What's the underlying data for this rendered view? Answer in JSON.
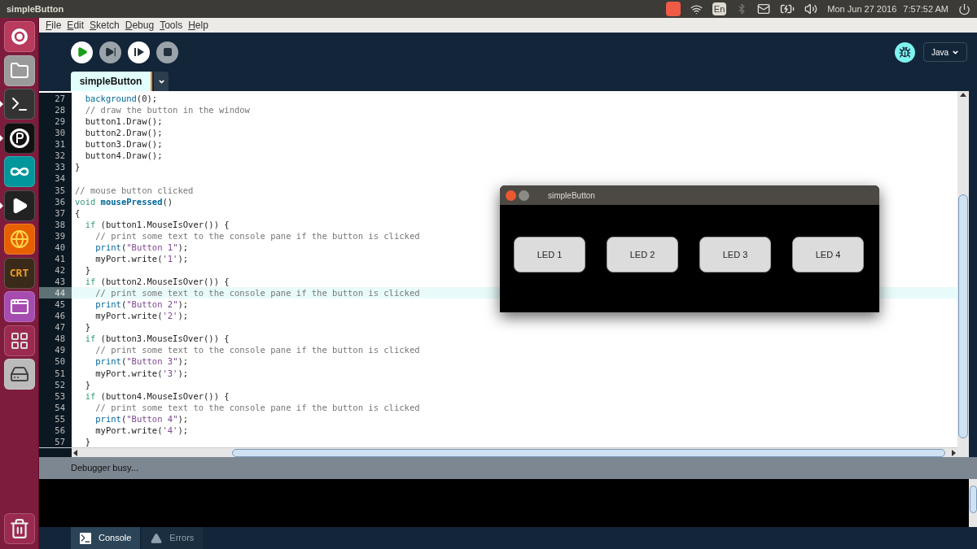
{
  "top_panel": {
    "title": "simpleButton",
    "keyboard": "En",
    "date": "Mon Jun 27 2016",
    "time": "7:57:52 AM"
  },
  "launcher": [
    {
      "kind": "dash",
      "running": false
    },
    {
      "kind": "files",
      "running": false
    },
    {
      "kind": "terminal",
      "running": true
    },
    {
      "kind": "processing",
      "running": true
    },
    {
      "kind": "arduino",
      "running": false
    },
    {
      "kind": "player",
      "running": true
    },
    {
      "kind": "firefox",
      "running": false
    },
    {
      "kind": "crt",
      "label": "CRT",
      "running": false
    },
    {
      "kind": "window",
      "running": false
    },
    {
      "kind": "workspaces",
      "running": false
    },
    {
      "kind": "drive",
      "running": false
    },
    {
      "kind": "trash",
      "running": false
    }
  ],
  "menu": [
    "File",
    "Edit",
    "Sketch",
    "Debug",
    "Tools",
    "Help"
  ],
  "toolbar": [
    {
      "kind": "run",
      "disabled": false
    },
    {
      "kind": "step",
      "disabled": true
    },
    {
      "kind": "continue",
      "disabled": false
    },
    {
      "kind": "stop",
      "disabled": true
    }
  ],
  "mode": {
    "label": "Java"
  },
  "tabs": [
    {
      "label": "simpleButton",
      "selected": true
    }
  ],
  "editor": {
    "lines": [
      {
        "number": "27",
        "current": false,
        "tokens": [
          {
            "kind": "func",
            "text": "  background"
          },
          {
            "kind": "plain",
            "text": "(0);"
          }
        ]
      },
      {
        "number": "28",
        "current": false,
        "tokens": [
          {
            "kind": "comment",
            "text": "  // draw the button in the window"
          }
        ]
      },
      {
        "number": "29",
        "current": false,
        "tokens": [
          {
            "kind": "plain",
            "text": "  button1.Draw();"
          }
        ]
      },
      {
        "number": "30",
        "current": false,
        "tokens": [
          {
            "kind": "plain",
            "text": "  button2.Draw();"
          }
        ]
      },
      {
        "number": "31",
        "current": false,
        "tokens": [
          {
            "kind": "plain",
            "text": "  button3.Draw();"
          }
        ]
      },
      {
        "number": "32",
        "current": false,
        "tokens": [
          {
            "kind": "plain",
            "text": "  button4.Draw();"
          }
        ]
      },
      {
        "number": "33",
        "current": false,
        "tokens": [
          {
            "kind": "plain",
            "text": "}"
          }
        ]
      },
      {
        "number": "34",
        "current": false
      },
      {
        "number": "35",
        "current": false,
        "tokens": [
          {
            "kind": "comment",
            "text": "// mouse button clicked"
          }
        ]
      },
      {
        "number": "36",
        "current": false,
        "tokens": [
          {
            "kind": "keyword",
            "text": "void "
          },
          {
            "kind": "funcdef",
            "text": "mousePressed"
          },
          {
            "kind": "plain",
            "text": "()"
          }
        ]
      },
      {
        "number": "37",
        "current": false,
        "tokens": [
          {
            "kind": "plain",
            "text": "{"
          }
        ]
      },
      {
        "number": "38",
        "current": false,
        "tokens": [
          {
            "kind": "keyword",
            "text": "  if"
          },
          {
            "kind": "plain",
            "text": " (button1.MouseIsOver()) {"
          }
        ]
      },
      {
        "number": "39",
        "current": false,
        "tokens": [
          {
            "kind": "comment",
            "text": "    // print some text to the console pane if the button is clicked"
          }
        ]
      },
      {
        "number": "40",
        "current": false,
        "tokens": [
          {
            "kind": "func",
            "text": "    print"
          },
          {
            "kind": "plain",
            "text": "("
          },
          {
            "kind": "string",
            "text": "\"Button 1\""
          },
          {
            "kind": "plain",
            "text": ");"
          }
        ]
      },
      {
        "number": "41",
        "current": false,
        "tokens": [
          {
            "kind": "plain",
            "text": "    myPort.write("
          },
          {
            "kind": "string",
            "text": "'1'"
          },
          {
            "kind": "plain",
            "text": ");"
          }
        ]
      },
      {
        "number": "42",
        "current": false,
        "tokens": [
          {
            "kind": "plain",
            "text": "  }"
          }
        ]
      },
      {
        "number": "43",
        "current": false,
        "tokens": [
          {
            "kind": "keyword",
            "text": "  if"
          },
          {
            "kind": "plain",
            "text": " (button2.MouseIsOver()) {"
          }
        ]
      },
      {
        "number": "44",
        "current": true,
        "tokens": [
          {
            "kind": "comment",
            "text": "    // print some text to the console pane if the button is clicked"
          }
        ]
      },
      {
        "number": "45",
        "current": false,
        "tokens": [
          {
            "kind": "func",
            "text": "    print"
          },
          {
            "kind": "plain",
            "text": "("
          },
          {
            "kind": "string",
            "text": "\"Button 2\""
          },
          {
            "kind": "plain",
            "text": ");"
          }
        ]
      },
      {
        "number": "46",
        "current": false,
        "tokens": [
          {
            "kind": "plain",
            "text": "    myPort.write("
          },
          {
            "kind": "string",
            "text": "'2'"
          },
          {
            "kind": "plain",
            "text": ");"
          }
        ]
      },
      {
        "number": "47",
        "current": false,
        "tokens": [
          {
            "kind": "plain",
            "text": "  }"
          }
        ]
      },
      {
        "number": "48",
        "current": false,
        "tokens": [
          {
            "kind": "keyword",
            "text": "  if"
          },
          {
            "kind": "plain",
            "text": " (button3.MouseIsOver()) {"
          }
        ]
      },
      {
        "number": "49",
        "current": false,
        "tokens": [
          {
            "kind": "comment",
            "text": "    // print some text to the console pane if the button is clicked"
          }
        ]
      },
      {
        "number": "50",
        "current": false,
        "tokens": [
          {
            "kind": "func",
            "text": "    print"
          },
          {
            "kind": "plain",
            "text": "("
          },
          {
            "kind": "string",
            "text": "\"Button 3\""
          },
          {
            "kind": "plain",
            "text": ");"
          }
        ]
      },
      {
        "number": "51",
        "current": false,
        "tokens": [
          {
            "kind": "plain",
            "text": "    myPort.write("
          },
          {
            "kind": "string",
            "text": "'3'"
          },
          {
            "kind": "plain",
            "text": ");"
          }
        ]
      },
      {
        "number": "52",
        "current": false,
        "tokens": [
          {
            "kind": "plain",
            "text": "  }"
          }
        ]
      },
      {
        "number": "53",
        "current": false,
        "tokens": [
          {
            "kind": "keyword",
            "text": "  if"
          },
          {
            "kind": "plain",
            "text": " (button4.MouseIsOver()) {"
          }
        ]
      },
      {
        "number": "54",
        "current": false,
        "tokens": [
          {
            "kind": "comment",
            "text": "    // print some text to the console pane if the button is clicked"
          }
        ]
      },
      {
        "number": "55",
        "current": false,
        "tokens": [
          {
            "kind": "func",
            "text": "    print"
          },
          {
            "kind": "plain",
            "text": "("
          },
          {
            "kind": "string",
            "text": "\"Button 4\""
          },
          {
            "kind": "plain",
            "text": ");"
          }
        ]
      },
      {
        "number": "56",
        "current": false,
        "tokens": [
          {
            "kind": "plain",
            "text": "    myPort.write("
          },
          {
            "kind": "string",
            "text": "'4'"
          },
          {
            "kind": "plain",
            "text": ");"
          }
        ]
      },
      {
        "number": "57",
        "current": false,
        "tokens": [
          {
            "kind": "plain",
            "text": "  }"
          }
        ]
      }
    ]
  },
  "sketch_window": {
    "title": "simpleButton",
    "buttons": [
      "LED 1",
      "LED 2",
      "LED 3",
      "LED 4"
    ]
  },
  "status_bar": {
    "text": "Debugger busy..."
  },
  "console_tabs": [
    {
      "label": "Console",
      "kind": "console",
      "selected": true
    },
    {
      "label": "Errors",
      "kind": "errors",
      "selected": false
    }
  ]
}
